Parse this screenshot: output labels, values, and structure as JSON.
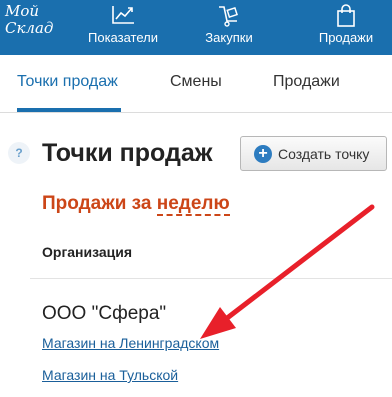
{
  "header": {
    "logo_line1": "Мой",
    "logo_line2": "Склад",
    "nav": [
      {
        "label": "Показатели",
        "icon": "chart-line-icon"
      },
      {
        "label": "Закупки",
        "icon": "hand-truck-icon"
      },
      {
        "label": "Продажи",
        "icon": "shopping-bag-icon"
      }
    ]
  },
  "tabs": [
    {
      "label": "Точки продаж",
      "active": true
    },
    {
      "label": "Смены",
      "active": false
    },
    {
      "label": "Продажи",
      "active": false
    }
  ],
  "page": {
    "help_glyph": "?",
    "title": "Точки продаж",
    "create_button": "Создать точку",
    "sales_prefix": "Продажи за ",
    "sales_period": "неделю",
    "column_header": "Организация",
    "organization": "ООО \"Сфера\"",
    "stores": [
      "Магазин на Ленинградском",
      "Магазин на Тульской"
    ]
  },
  "colors": {
    "brand": "#1a6fae",
    "accent_orange": "#cc4618",
    "annotation_arrow": "#e8202a"
  }
}
